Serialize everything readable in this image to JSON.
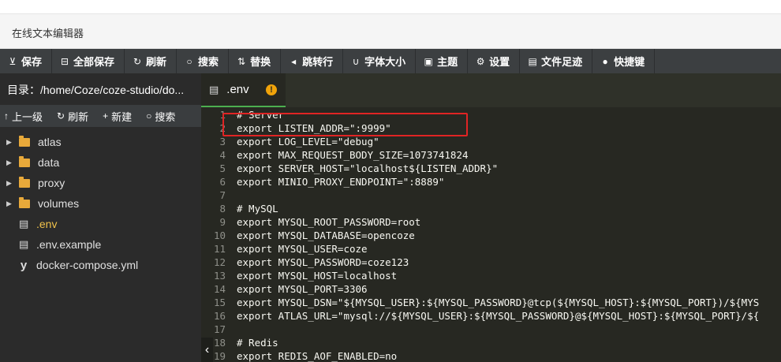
{
  "app": {
    "title": "在线文本编辑器"
  },
  "toolbar": {
    "buttons": [
      {
        "label": "保存",
        "icon": "save-icon"
      },
      {
        "label": "全部保存",
        "icon": "save-all-icon"
      },
      {
        "label": "刷新",
        "icon": "refresh-icon"
      },
      {
        "label": "搜索",
        "icon": "search-icon"
      },
      {
        "label": "替换",
        "icon": "replace-icon"
      },
      {
        "label": "跳转行",
        "icon": "jump-line-icon"
      },
      {
        "label": "字体大小",
        "icon": "font-size-icon"
      },
      {
        "label": "主题",
        "icon": "theme-icon"
      },
      {
        "label": "设置",
        "icon": "settings-icon"
      },
      {
        "label": "文件足迹",
        "icon": "history-icon"
      },
      {
        "label": "快捷键",
        "icon": "help-icon"
      }
    ]
  },
  "sidebar": {
    "path": "目录：/home/Coze/coze-studio/do...",
    "actions": [
      {
        "label": "上一级",
        "icon": "up-arrow-icon"
      },
      {
        "label": "刷新",
        "icon": "refresh-icon"
      },
      {
        "label": "新建",
        "icon": "plus-icon"
      },
      {
        "label": "搜索",
        "icon": "search-icon"
      }
    ],
    "tree": [
      {
        "name": "atlas",
        "type": "folder"
      },
      {
        "name": "data",
        "type": "folder"
      },
      {
        "name": "proxy",
        "type": "folder"
      },
      {
        "name": "volumes",
        "type": "folder"
      },
      {
        "name": ".env",
        "type": "file",
        "active": true
      },
      {
        "name": ".env.example",
        "type": "file"
      },
      {
        "name": "docker-compose.yml",
        "type": "yaml"
      }
    ]
  },
  "editor": {
    "tab": {
      "label": ".env",
      "warning": "!"
    },
    "lines": [
      "# Server",
      "export LISTEN_ADDR=\":9999\"",
      "export LOG_LEVEL=\"debug\"",
      "export MAX_REQUEST_BODY_SIZE=1073741824",
      "export SERVER_HOST=\"localhost${LISTEN_ADDR}\"",
      "export MINIO_PROXY_ENDPOINT=\":8889\"",
      "",
      "# MySQL",
      "export MYSQL_ROOT_PASSWORD=root",
      "export MYSQL_DATABASE=opencoze",
      "export MYSQL_USER=coze",
      "export MYSQL_PASSWORD=coze123",
      "export MYSQL_HOST=localhost",
      "export MYSQL_PORT=3306",
      "export MYSQL_DSN=\"${MYSQL_USER}:${MYSQL_PASSWORD}@tcp(${MYSQL_HOST}:${MYSQL_PORT})/${MYS",
      "export ATLAS_URL=\"mysql://${MYSQL_USER}:${MYSQL_PASSWORD}@${MYSQL_HOST}:${MYSQL_PORT}/${",
      "",
      "# Redis",
      "export REDIS_AOF_ENABLED=no"
    ],
    "line_numbers": [
      "1",
      "2",
      "3",
      "4",
      "5",
      "6",
      "7",
      "8",
      "9",
      "10",
      "11",
      "12",
      "13",
      "14",
      "15",
      "16",
      "17",
      "18",
      "19"
    ]
  }
}
